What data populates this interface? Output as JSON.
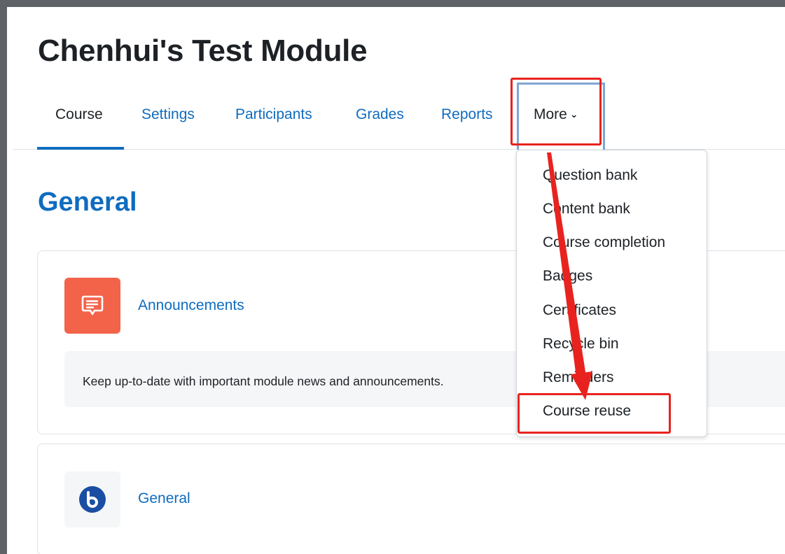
{
  "header": {
    "title": "Chenhui's Test Module"
  },
  "nav": {
    "tabs": [
      {
        "label": "Course"
      },
      {
        "label": "Settings"
      },
      {
        "label": "Participants"
      },
      {
        "label": "Grades"
      },
      {
        "label": "Reports"
      }
    ],
    "more_label": "More",
    "active_tab": "Course"
  },
  "more_menu": {
    "items": [
      {
        "label": "Question bank"
      },
      {
        "label": "Content bank"
      },
      {
        "label": "Course completion"
      },
      {
        "label": "Badges"
      },
      {
        "label": "Certificates"
      },
      {
        "label": "Recycle bin"
      },
      {
        "label": "Reminders"
      },
      {
        "label": "Course reuse"
      }
    ],
    "highlighted_item": "Course reuse"
  },
  "section": {
    "title": "General",
    "activities": [
      {
        "name": "Announcements",
        "icon": "forum-chat-icon",
        "description": "Keep up-to-date with important module news and announcements."
      },
      {
        "name": "General",
        "icon": "bigbluebutton-icon"
      }
    ]
  },
  "colors": {
    "primary": "#0f6cbf",
    "forum_icon_bg": "#f3634a",
    "annotation_red": "#e8231f",
    "bbb_blue": "#1a4ea3"
  }
}
